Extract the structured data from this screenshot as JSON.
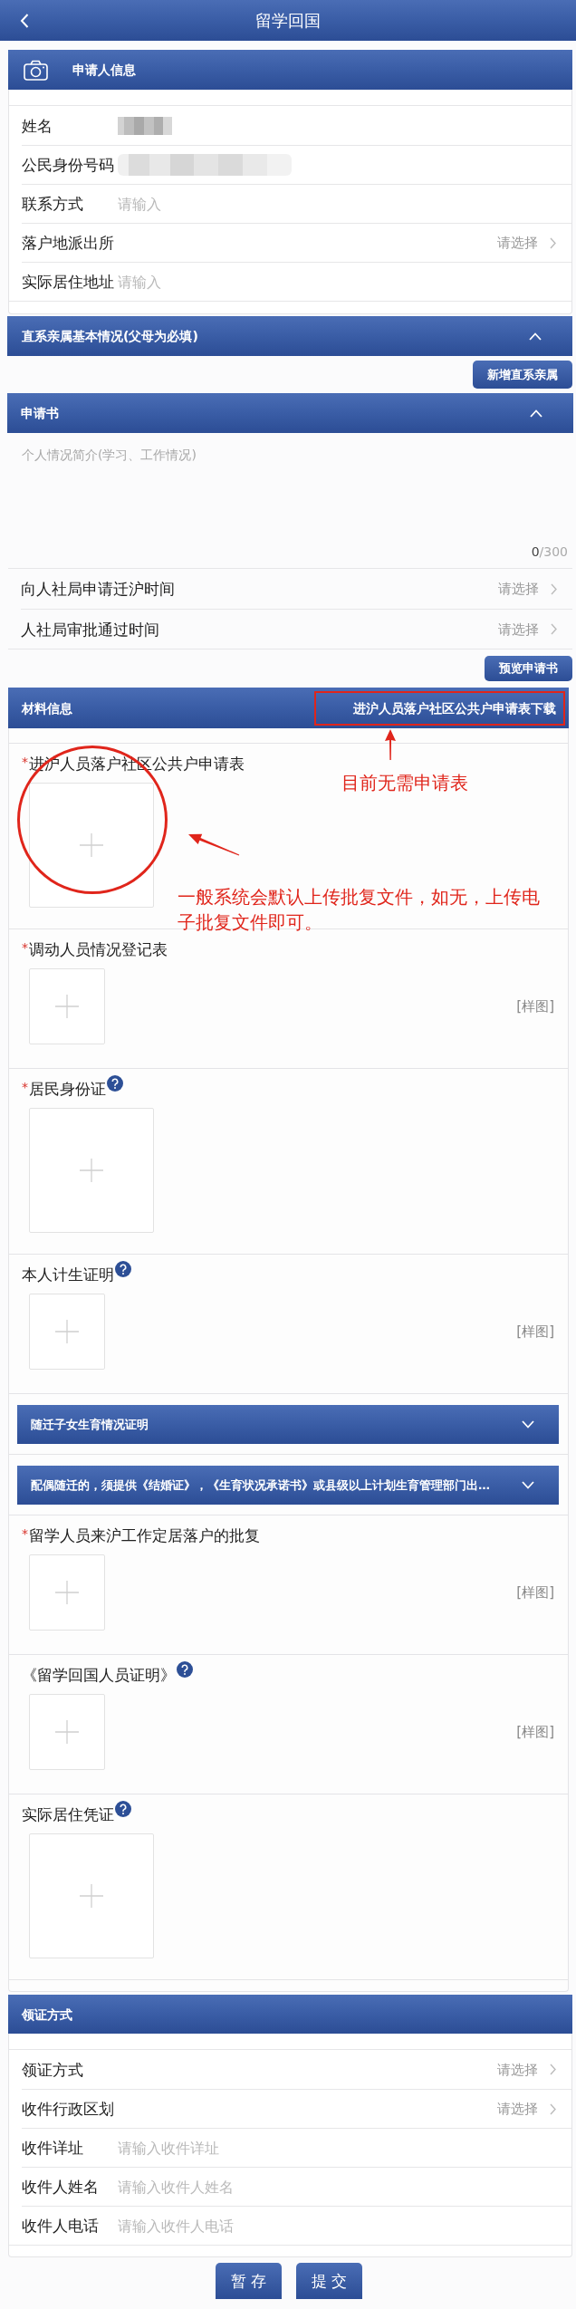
{
  "nav": {
    "title": "留学回国"
  },
  "applicant": {
    "title": "申请人信息",
    "rows": [
      {
        "kind": "redacted",
        "label": "姓名"
      },
      {
        "kind": "redacted",
        "label": "公民身份号码"
      },
      {
        "kind": "input",
        "label": "联系方式",
        "placeholder": "请输入"
      },
      {
        "kind": "select",
        "label": "落户地派出所",
        "placeholder": "请选择"
      },
      {
        "kind": "input",
        "label": "实际居住地址",
        "placeholder": "请输入"
      }
    ]
  },
  "relatives": {
    "title": "直系亲属基本情况(父母为必填)",
    "expanded": true,
    "add_button": "新增直系亲属"
  },
  "application": {
    "title": "申请书",
    "expanded": true,
    "intro": {
      "placeholder": "个人情况简介(学习、工作情况)",
      "count": "0",
      "limit": "/300"
    },
    "rows": [
      {
        "kind": "select",
        "label": "向人社局申请迁沪时间",
        "placeholder": "请选择"
      },
      {
        "kind": "select",
        "label": "人社局审批通过时间",
        "placeholder": "请选择"
      }
    ],
    "preview_button": "预览申请书"
  },
  "materials": {
    "title": "材料信息",
    "download_link": "进沪人员落户社区公共户申请表下载",
    "required_mark": "*",
    "items": [
      {
        "kind": "large",
        "label": "进沪人员落户社区公共户申请表",
        "required": true,
        "help": false
      },
      {
        "kind": "small",
        "label": "调动人员情况登记表",
        "required": true,
        "help": false,
        "sample": "[样图]"
      },
      {
        "kind": "large",
        "label": "居民身份证",
        "required": true,
        "help": true
      },
      {
        "kind": "small",
        "label": "本人计生证明",
        "required": false,
        "help": true,
        "sample": "[样图]"
      },
      {
        "kind": "group",
        "title": "随迁子女生育情况证明",
        "expanded": false
      },
      {
        "kind": "group",
        "title": "配偶随迁的，须提供《结婚证》，《生育状况承诺书》或县级以上计划生育管理部门出…",
        "expanded": false
      },
      {
        "kind": "small",
        "label": "留学人员来沪工作定居落户的批复",
        "required": true,
        "help": false,
        "sample": "[样图]"
      },
      {
        "kind": "small",
        "label": "《留学回国人员证明》",
        "required": false,
        "help": true,
        "sample": "[样图]"
      },
      {
        "kind": "large",
        "label": "实际居住凭证",
        "required": false,
        "help": true
      }
    ],
    "annotations": [
      {
        "kind": "label",
        "text": "目前无需申请表"
      },
      {
        "kind": "paragraph",
        "text": "一般系统会默认上传批复文件，如无，上传电子批复文件即可。"
      }
    ]
  },
  "certificate": {
    "title": "领证方式",
    "rows": [
      {
        "kind": "select",
        "label": "领证方式",
        "placeholder": "请选择"
      },
      {
        "kind": "select",
        "label": "收件行政区划",
        "placeholder": "请选择"
      },
      {
        "kind": "input",
        "label": "收件详址",
        "placeholder": "请输入收件详址"
      },
      {
        "kind": "input",
        "label": "收件人姓名",
        "placeholder": "请输入收件人姓名"
      },
      {
        "kind": "input",
        "label": "收件人电话",
        "placeholder": "请输入收件人电话"
      }
    ]
  },
  "buttons": [
    "暂 存",
    "提 交"
  ]
}
